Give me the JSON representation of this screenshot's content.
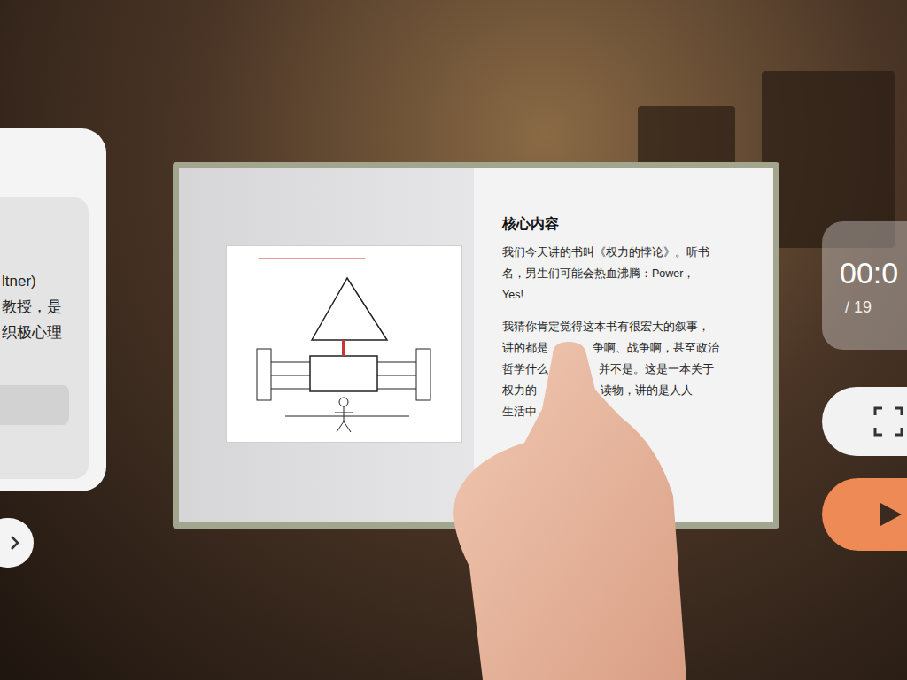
{
  "left_panel": {
    "lines": [
      "ltner)",
      "教授，是",
      "织极心理"
    ]
  },
  "book": {
    "heading": "核心内容",
    "intro": "我们今天讲的书叫《权力的悖论》。听书名，男生们可能会热血沸腾：Power，Yes!",
    "lines": [
      [
        "我猜你肯定觉得这本书有很宏大的叙事，",
        ""
      ],
      [
        "讲的都是",
        "争啊、战争啊，甚至政治"
      ],
      [
        "哲学什么",
        "并不是。这是一本关于"
      ],
      [
        "权力的",
        "读物，讲的是人人"
      ],
      [
        "生活中",
        ""
      ]
    ]
  },
  "player": {
    "time": "00:0",
    "duration": "/ 19"
  }
}
